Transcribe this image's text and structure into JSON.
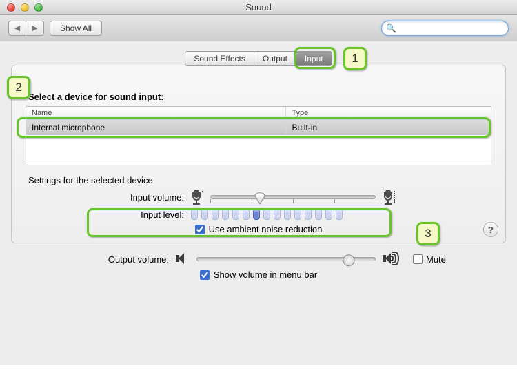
{
  "window": {
    "title": "Sound"
  },
  "toolbar": {
    "back_label": "◀",
    "fwd_label": "▶",
    "show_all_label": "Show All",
    "search_placeholder": ""
  },
  "tabs": {
    "sound_effects": "Sound Effects",
    "output": "Output",
    "input": "Input",
    "selected": "input"
  },
  "input_section": {
    "select_label": "Select a device for sound input:",
    "columns": {
      "name": "Name",
      "type": "Type"
    },
    "devices": [
      {
        "name": "Internal microphone",
        "type": "Built-in",
        "selected": true
      }
    ],
    "settings_label": "Settings for the selected device:",
    "input_volume_label": "Input volume:",
    "input_volume_value": 30,
    "input_volume_ticks": 5,
    "input_level_label": "Input level:",
    "input_level_count": 15,
    "input_level_active_index": 6,
    "ambient_label": "Use ambient noise reduction",
    "ambient_checked": true
  },
  "output_section": {
    "output_volume_label": "Output volume:",
    "output_volume_value": 85,
    "mute_label": "Mute",
    "mute_checked": false,
    "show_menu_label": "Show volume in menu bar",
    "show_menu_checked": true
  },
  "help_label": "?",
  "annotations": {
    "n1": "1",
    "n2": "2",
    "n3": "3"
  }
}
